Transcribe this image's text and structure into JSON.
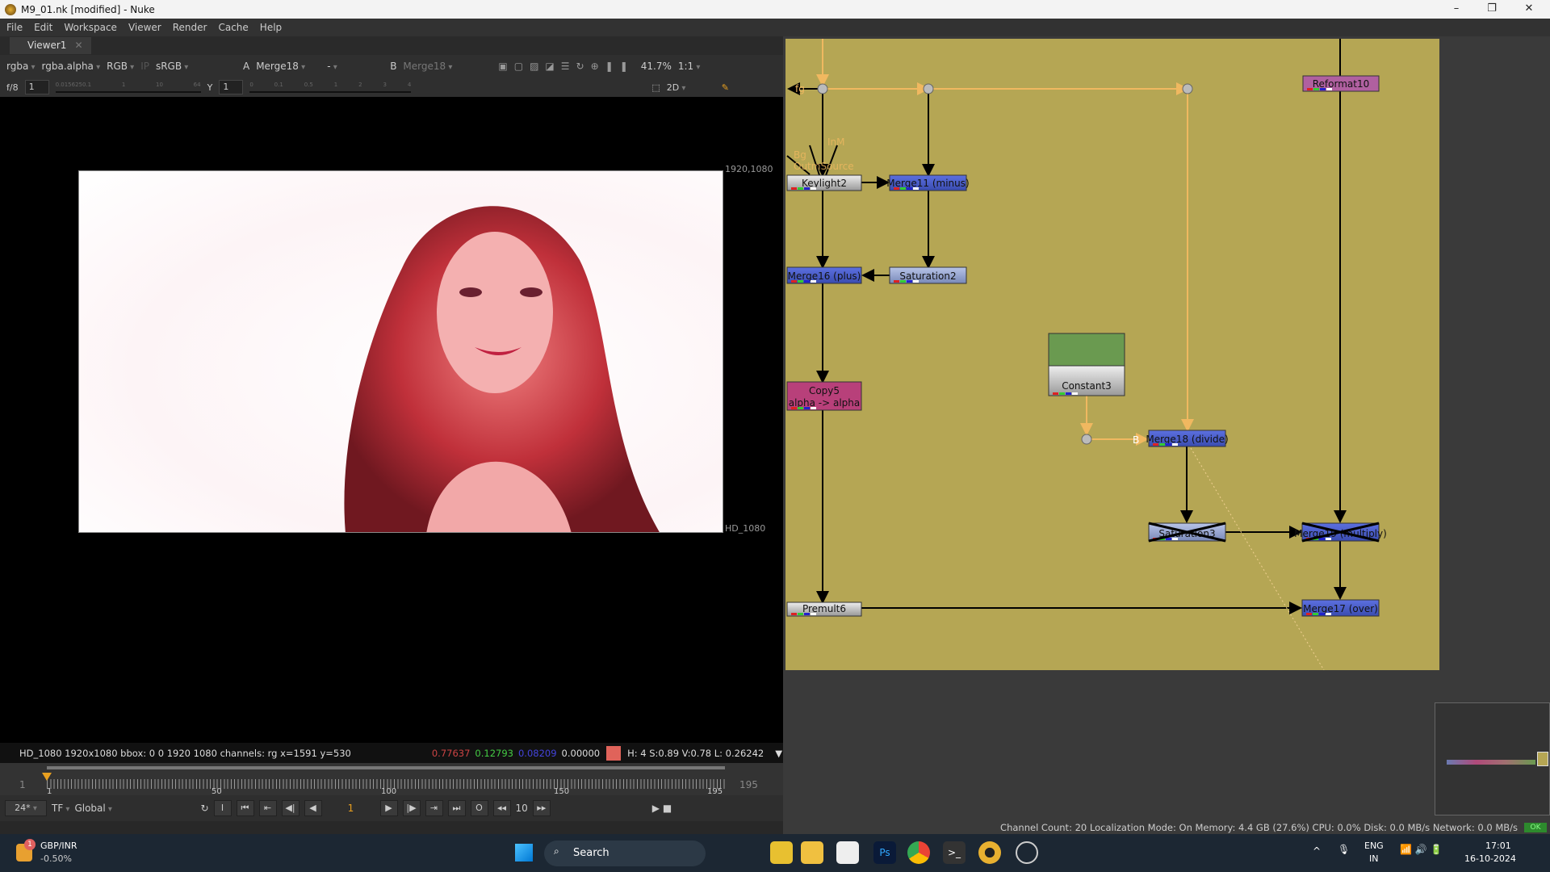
{
  "window": {
    "title": "M9_01.nk [modified] - Nuke",
    "minimize": "–",
    "maximize": "❐",
    "close": "✕"
  },
  "menu": [
    "File",
    "Edit",
    "Workspace",
    "Viewer",
    "Render",
    "Cache",
    "Help"
  ],
  "viewer_tab": {
    "label": "Viewer1",
    "close": "✕"
  },
  "viewer_toolbar": {
    "channels": "rgba",
    "alpha": "rgba.alpha",
    "display": "RGB",
    "ip": "IP",
    "lut": "sRGB",
    "a_label": "A",
    "a_input": "Merge18",
    "mid": "-",
    "b_label": "B",
    "b_input": "Merge18",
    "zoom": "41.7%",
    "ratio": "1:1"
  },
  "viewer_toolbar2": {
    "fstop": "f/8",
    "gain": "1",
    "gain_ticks": [
      "0.0156250.1",
      "1",
      "10",
      "64"
    ],
    "gamma_label": "Y",
    "gamma": "1",
    "gamma_ticks": [
      "0",
      "0.1",
      "0.5",
      "1",
      "2",
      "3",
      "4"
    ],
    "view_mode": "2D"
  },
  "viewer": {
    "top_right_label": "1920,1080",
    "format_label": "HD_1080"
  },
  "infobar": {
    "format": "HD_1080 1920x1080  bbox: 0 0 1920 1080 channels: rg  x=1591 y=530",
    "r": "0.77637",
    "g": "0.12793",
    "b": "0.08209",
    "a": "0.00000",
    "swatch_color": "#e0635a",
    "hsvl": "H:  4 S:0.89 V:0.78  L: 0.26242"
  },
  "timeline": {
    "start": "1",
    "end": "195",
    "ticks": [
      "1",
      "50",
      "100",
      "150",
      "195"
    ],
    "current": "1"
  },
  "controls": {
    "fps": "24*",
    "tf": "TF",
    "scope": "Global",
    "frame": "1",
    "step": "10",
    "in": "I",
    "out": "O"
  },
  "nodes": [
    {
      "name": "Keylight2",
      "type": "keyer"
    },
    {
      "name": "Merge11 (minus)",
      "type": "merge"
    },
    {
      "name": "Merge16 (plus)",
      "type": "merge"
    },
    {
      "name": "Saturation2",
      "type": "color"
    },
    {
      "name": "Copy5",
      "sub": "alpha -> alpha",
      "type": "channel"
    },
    {
      "name": "Constant3",
      "type": "constant"
    },
    {
      "name": "Reformat10",
      "type": "transform"
    },
    {
      "name": "Merge18 (divide)",
      "type": "merge"
    },
    {
      "name": "Saturation3",
      "type": "color",
      "disabled": true
    },
    {
      "name": "Merge19 (multiply)",
      "type": "merge",
      "disabled": true
    },
    {
      "name": "Merge17 (over)",
      "type": "merge"
    },
    {
      "name": "Premult6",
      "type": "merge"
    }
  ],
  "input_labels": {
    "fg": "fg",
    "bg": "Bg",
    "inm": "InM",
    "source": "OutmSource",
    "a": "A",
    "b": "B"
  },
  "status": {
    "text": "Channel Count: 20 Localization Mode: On Memory: 4.4 GB (27.6%) CPU: 0.0% Disk: 0.0 MB/s Network: 0.0 MB/s",
    "ok": "OK"
  },
  "taskbar": {
    "widget_title": "GBP/INR",
    "widget_value": "-0.50%",
    "widget_badge": "1",
    "search": "Search",
    "lang1": "ENG",
    "lang2": "IN",
    "time": "17:01",
    "date": "16-10-2024"
  },
  "colors": {
    "graph_bg": "#b5a654",
    "merge": "#4a5fc8",
    "pipe_orange": "#f0b860"
  }
}
